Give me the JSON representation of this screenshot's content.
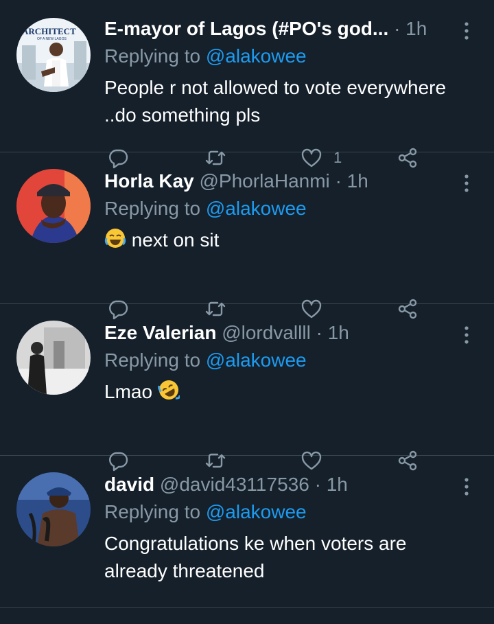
{
  "replies": [
    {
      "name": "E-mayor of Lagos (#PO's god...",
      "handle": "",
      "time": "1h",
      "replying_prefix": "Replying to ",
      "mention": "@alakowee",
      "text_line1": "People r not allowed to vote everywhere",
      "text_line2": "..do something pls",
      "like_count": "1",
      "avatar_text": "ARCHITECT",
      "avatar_subtext": "OF A NEW LAGOS"
    },
    {
      "name": "Horla Kay",
      "handle": "@PhorlaHanmi",
      "time": "1h",
      "replying_prefix": "Replying to ",
      "mention": "@alakowee",
      "text": "next on sit",
      "emoji": "face-with-tears-of-joy"
    },
    {
      "name": "Eze Valerian",
      "handle": "@lordvallll",
      "time": "1h",
      "replying_prefix": "Replying to ",
      "mention": "@alakowee",
      "text": "Lmao",
      "emoji": "rolling-on-the-floor-laughing"
    },
    {
      "name": "david",
      "handle": "@david43117536",
      "time": "1h",
      "replying_prefix": "Replying to ",
      "mention": "@alakowee",
      "text_line1": "Congratulations ke when voters are",
      "text_line2": "already threatened"
    }
  ],
  "separator": "·",
  "colors": {
    "background": "#15202b",
    "muted": "#8899a6",
    "accent": "#1d9bf0",
    "divider": "#38444d"
  }
}
